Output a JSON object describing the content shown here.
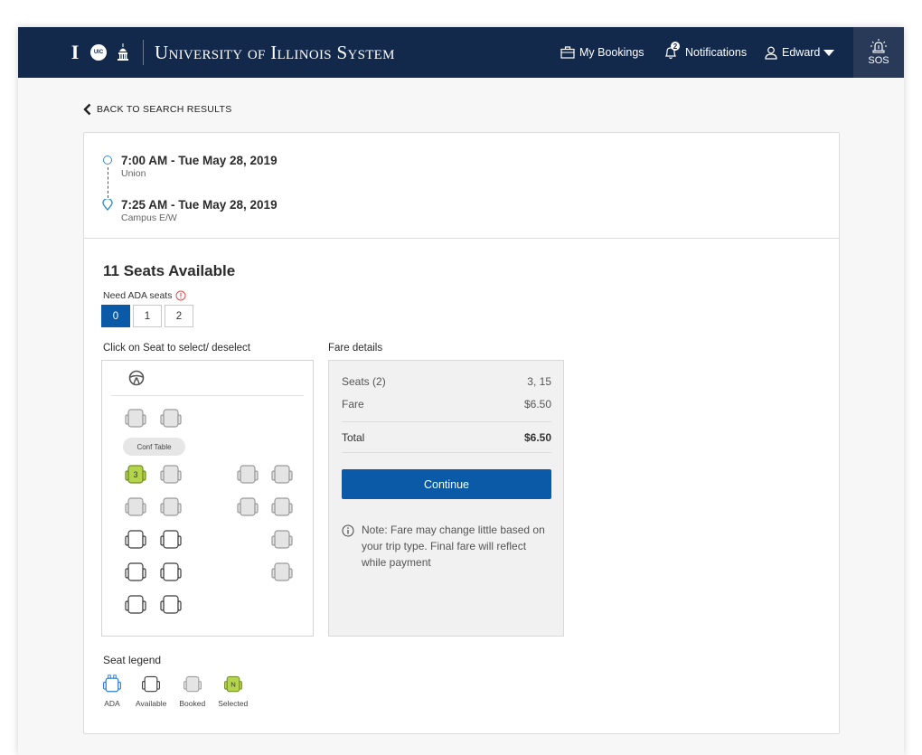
{
  "header": {
    "title": "University of Illinois System",
    "logo_uic": "UIC",
    "nav": {
      "bookings": "My Bookings",
      "notifications": "Notifications",
      "notification_count": "2",
      "user": "Edward"
    },
    "sos": "SOS"
  },
  "back_link": "BACK TO SEARCH RESULTS",
  "trip": {
    "departure": {
      "time": "7:00 AM - Tue May 28, 2019",
      "place": "Union"
    },
    "arrival": {
      "time": "7:25 AM - Tue May 28, 2019",
      "place": "Campus E/W"
    }
  },
  "seats": {
    "title": "11 Seats Available",
    "ada_label": "Need ADA seats",
    "ada_options": [
      "0",
      "1",
      "2"
    ],
    "ada_selected": "0",
    "map_label": "Click on Seat to select/ deselect",
    "conf_table": "Conf Table",
    "selected_seat": "3"
  },
  "fare": {
    "label": "Fare details",
    "rows": [
      {
        "label": "Seats (2)",
        "value": "3, 15"
      },
      {
        "label": "Fare",
        "value": "$6.50"
      }
    ],
    "total_label": "Total",
    "total_value": "$6.50",
    "continue": "Continue",
    "note": "Note: Fare may change little based on your trip type. Final fare will reflect while payment"
  },
  "legend": {
    "title": "Seat legend",
    "items": [
      "ADA",
      "Available",
      "Booked",
      "Selected"
    ],
    "selected_letter": "N"
  },
  "colors": {
    "header_bg": "#13294b",
    "primary": "#0b5aa8",
    "selected_seat": "#b5d44e",
    "booked_seat": "#e4e4e4",
    "ada_seat": "#2f7fd0"
  }
}
